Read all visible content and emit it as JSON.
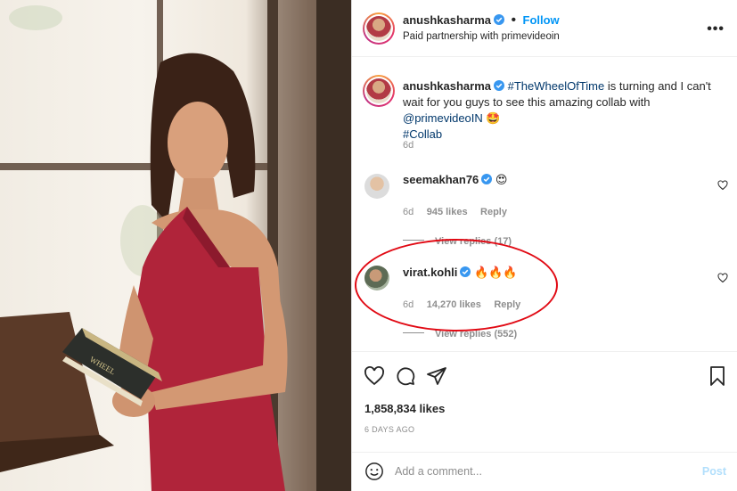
{
  "post": {
    "author": "anushkasharma",
    "follow_label": "Follow",
    "subtitle": "Paid partnership with primevideoin",
    "more_label": "•••"
  },
  "caption": {
    "username": "anushkasharma",
    "hashtag": "#TheWheelOfTime",
    "text": " is turning and I can't wait for you guys to see this amazing collab with ",
    "mention": "@primevideoIN",
    "emoji": "🤩",
    "hashtag2": "#Collab",
    "age": "6d"
  },
  "comments": [
    {
      "username": "seemakhan76",
      "text": "😍",
      "age": "6d",
      "likes": "945 likes",
      "reply_label": "Reply",
      "view_replies": "View replies (17)"
    },
    {
      "username": "virat.kohli",
      "text": "🔥🔥🔥",
      "age": "6d",
      "likes": "14,270 likes",
      "reply_label": "Reply",
      "view_replies": "View replies (552)"
    }
  ],
  "actions": {
    "likes_count": "1,858,834 likes",
    "date": "6 DAYS AGO"
  },
  "comment_box": {
    "placeholder": "Add a comment...",
    "post_label": "Post"
  },
  "colors": {
    "accent": "#0095f6",
    "highlight": "#e10a14",
    "dress": "#b0243a"
  }
}
